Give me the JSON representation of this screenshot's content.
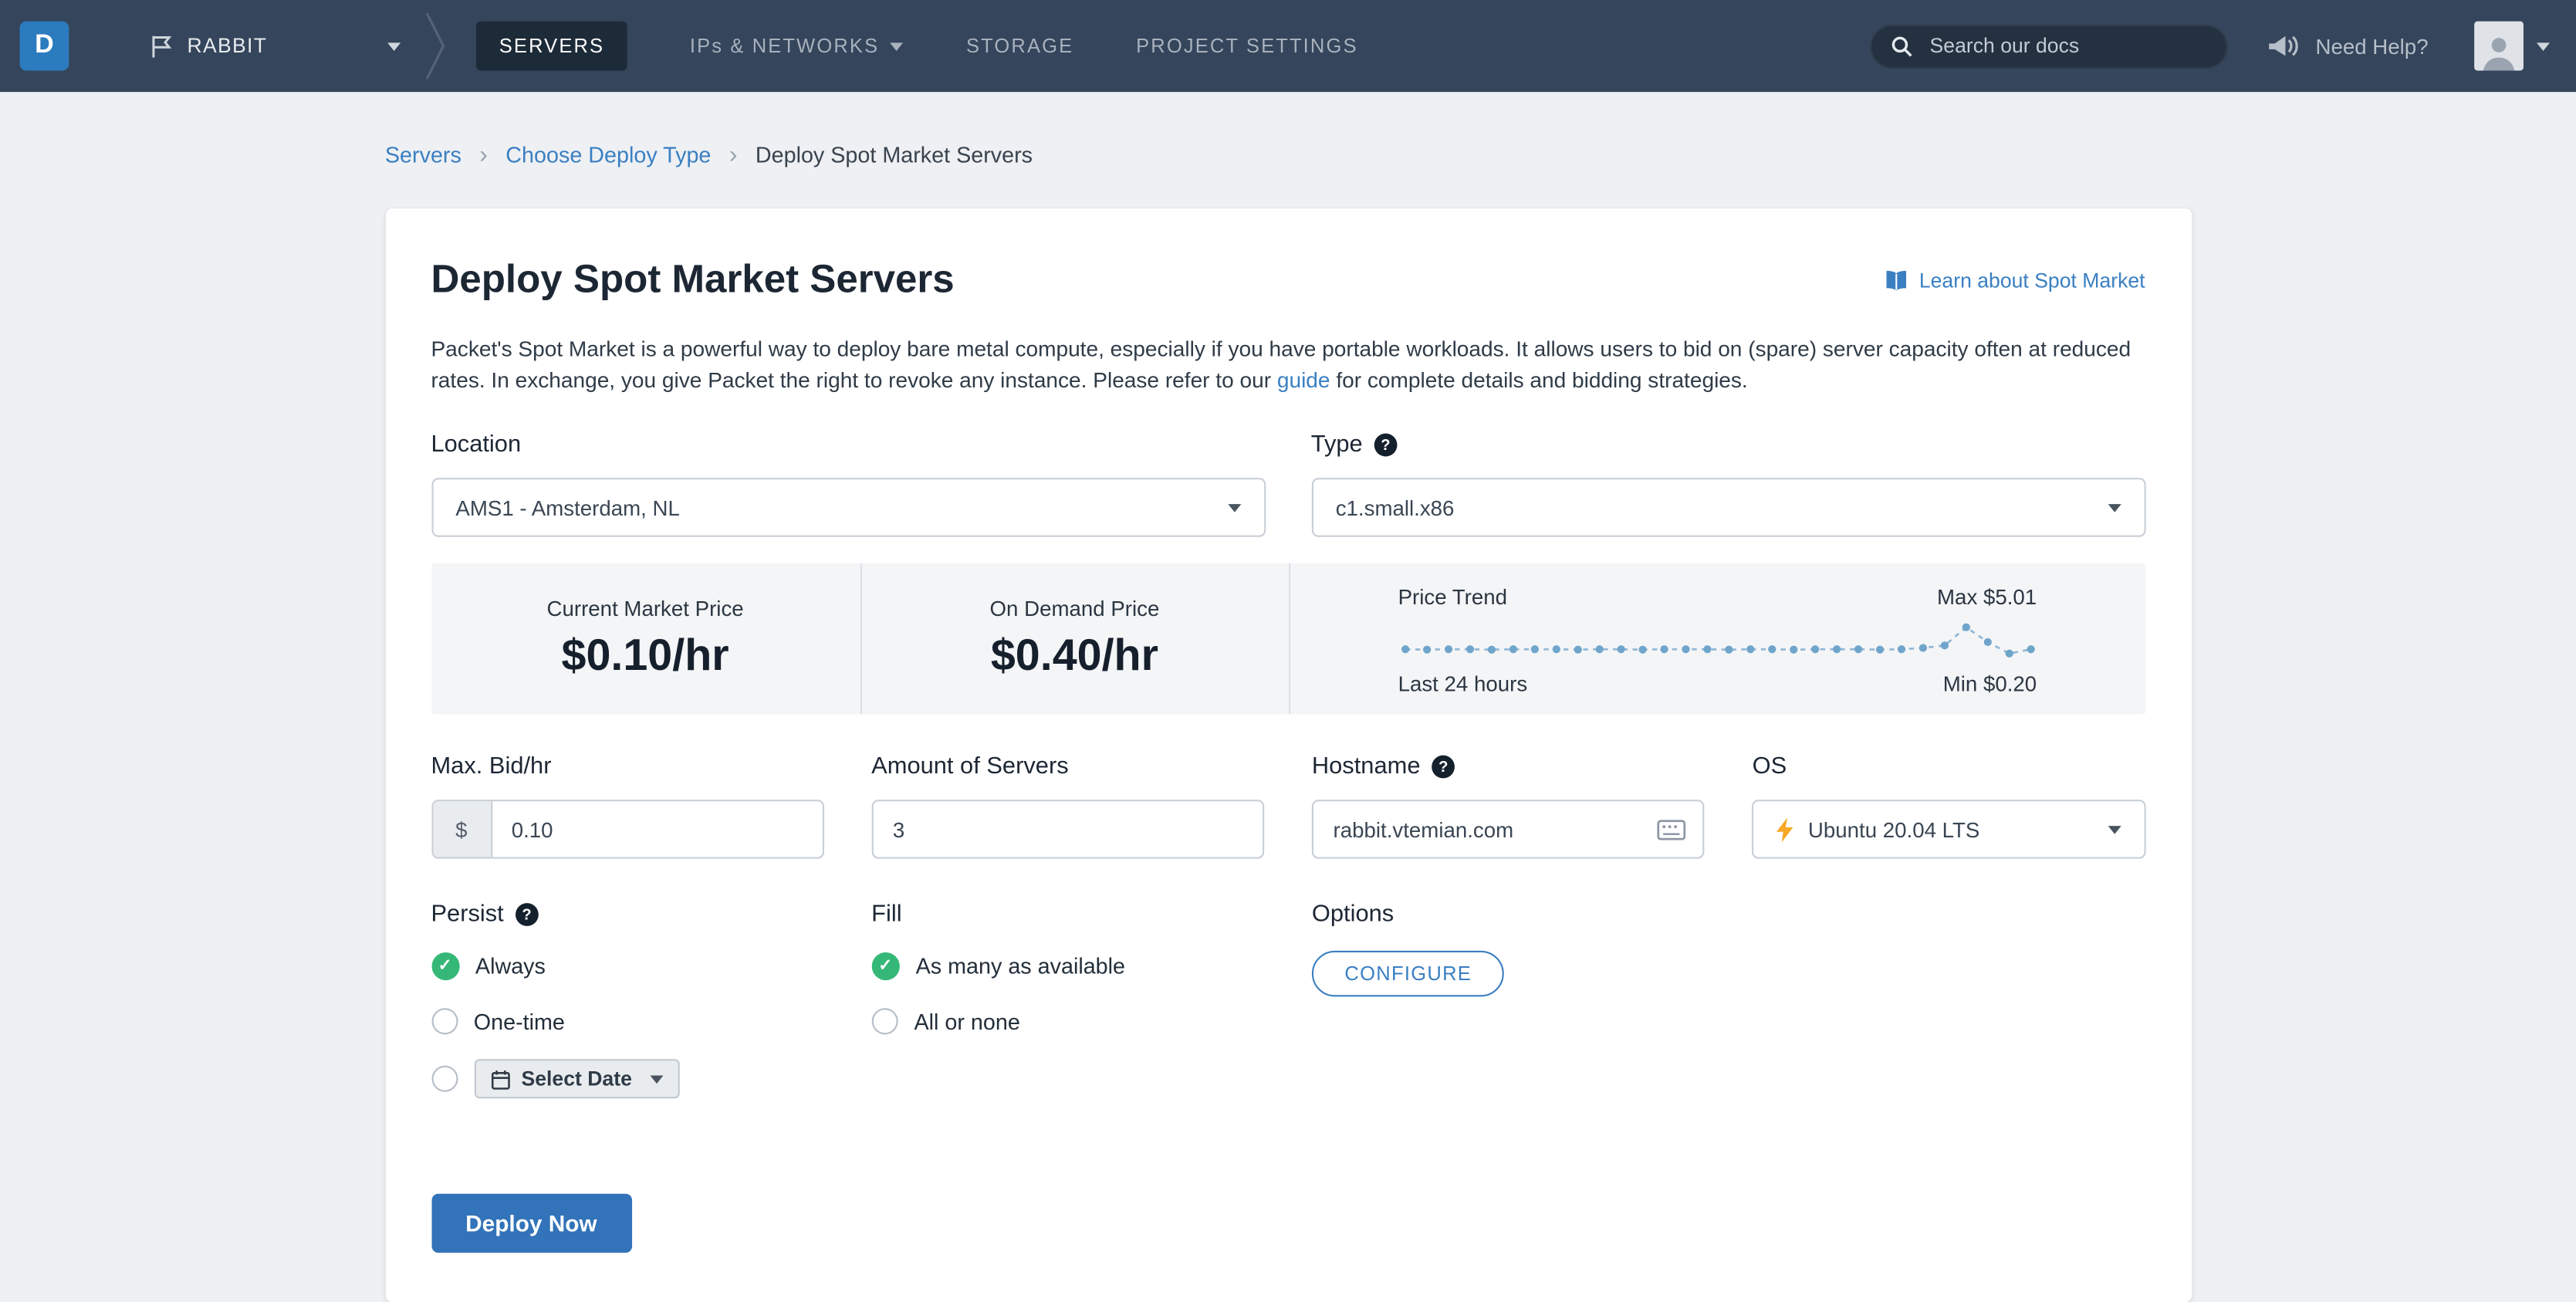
{
  "navbar": {
    "logo_letter": "D",
    "project": {
      "name": "RABBIT"
    },
    "items": [
      {
        "label": "SERVERS",
        "active": true
      },
      {
        "label": "IPs & NETWORKS",
        "has_caret": true
      },
      {
        "label": "STORAGE",
        "active": false
      },
      {
        "label": "PROJECT SETTINGS",
        "active": false
      }
    ],
    "search_placeholder": "Search our docs",
    "help_label": "Need Help?"
  },
  "breadcrumb": {
    "items": [
      {
        "label": "Servers"
      },
      {
        "label": "Choose Deploy Type"
      },
      {
        "label": "Deploy Spot Market Servers"
      }
    ]
  },
  "page": {
    "title": "Deploy Spot Market Servers",
    "learn_link": "Learn about Spot Market",
    "intro_before": "Packet's Spot Market is a powerful way to deploy bare metal compute, especially if you have portable workloads. It allows users to bid on (spare) server capacity often at reduced rates. In exchange, you give Packet the right to revoke any instance. Please refer to our ",
    "intro_link": "guide",
    "intro_after": " for complete details and bidding strategies."
  },
  "pricing": {
    "market": {
      "label": "Current Market Price",
      "value": "$0.10/hr"
    },
    "on_demand": {
      "label": "On Demand Price",
      "value": "$0.40/hr"
    },
    "trend": {
      "label": "Price Trend",
      "max_label": "Max $5.01",
      "min_label": "Min $0.20",
      "period_label": "Last 24 hours"
    }
  },
  "chart_data": {
    "type": "line",
    "title": "Price Trend",
    "xlabel": "Last 24 hours",
    "ylim": [
      0.2,
      5.01
    ],
    "values": [
      0.25,
      0.24,
      0.25,
      0.25,
      0.24,
      0.25,
      0.25,
      0.25,
      0.24,
      0.25,
      0.25,
      0.24,
      0.25,
      0.25,
      0.25,
      0.24,
      0.25,
      0.25,
      0.24,
      0.25,
      0.25,
      0.25,
      0.24,
      0.25,
      0.3,
      0.45,
      5.01,
      0.8,
      0.2,
      0.25
    ],
    "max_annotation": "Max $5.01",
    "min_annotation": "Min $0.20",
    "style": "dotted sparkline with dashed connectors"
  },
  "form": {
    "location": {
      "label": "Location",
      "value": "AMS1 - Amsterdam, NL"
    },
    "type": {
      "label": "Type",
      "value": "c1.small.x86"
    },
    "max_bid": {
      "label": "Max. Bid/hr",
      "prefix": "$",
      "value": "0.10"
    },
    "amount": {
      "label": "Amount of Servers",
      "value": "3"
    },
    "hostname": {
      "label": "Hostname",
      "value": "rabbit.vtemian.com"
    },
    "os": {
      "label": "OS",
      "value": "Ubuntu 20.04 LTS"
    },
    "persist": {
      "label": "Persist",
      "options": [
        {
          "label": "Always",
          "selected": true
        },
        {
          "label": "One-time",
          "selected": false
        },
        {
          "label": "Select Date",
          "selected": false,
          "is_date_picker": true
        }
      ]
    },
    "fill": {
      "label": "Fill",
      "options": [
        {
          "label": "As many as available",
          "selected": true
        },
        {
          "label": "All or none",
          "selected": false
        }
      ]
    },
    "options": {
      "label": "Options",
      "button": "CONFIGURE"
    },
    "deploy_button": "Deploy Now"
  },
  "icons": {
    "help": "?",
    "check": "✓"
  },
  "colors": {
    "navbar_bg": "#35455b",
    "accent_blue": "#3a7fc2",
    "button_blue": "#3273b9",
    "success_green": "#35b877",
    "bolt_orange": "#f7a824",
    "panel_bg": "#f4f5f7",
    "page_bg": "#eef0f3"
  }
}
